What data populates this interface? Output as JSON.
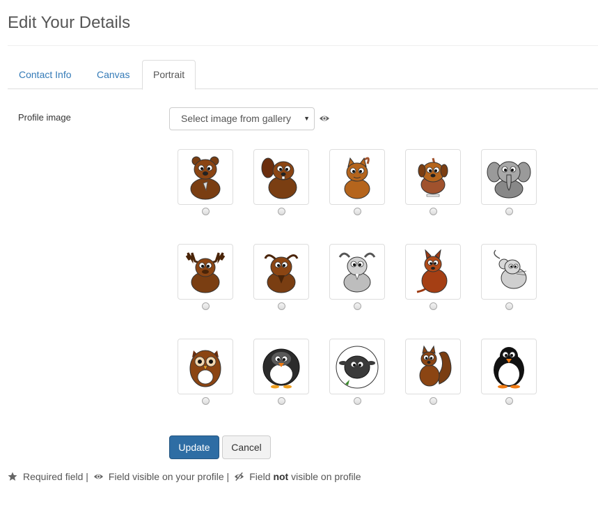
{
  "page": {
    "title": "Edit Your Details"
  },
  "tabs": [
    {
      "label": "Contact Info",
      "active": false
    },
    {
      "label": "Canvas",
      "active": false
    },
    {
      "label": "Portrait",
      "active": true
    }
  ],
  "form": {
    "profile_image_label": "Profile image",
    "select_value": "Select image from gallery",
    "select_icon": "chevron-down-icon",
    "visibility_icon": "eye-icon"
  },
  "gallery": {
    "selected_index": null,
    "images": [
      {
        "name": "bear"
      },
      {
        "name": "beaver"
      },
      {
        "name": "cat"
      },
      {
        "name": "dog"
      },
      {
        "name": "elephant"
      },
      {
        "name": "moose"
      },
      {
        "name": "gnu"
      },
      {
        "name": "goat"
      },
      {
        "name": "kangaroo"
      },
      {
        "name": "mouse"
      },
      {
        "name": "owl"
      },
      {
        "name": "penguin-grey"
      },
      {
        "name": "sheep"
      },
      {
        "name": "squirrel"
      },
      {
        "name": "penguin"
      }
    ]
  },
  "buttons": {
    "update": "Update",
    "cancel": "Cancel"
  },
  "legend": {
    "required": "Required field |",
    "visible": "Field visible on your profile |",
    "not_visible_prefix": "Field",
    "not_visible_bold": "not",
    "not_visible_suffix": "visible on profile"
  },
  "colors": {
    "link": "#337ab7",
    "primary": "#2e6da4",
    "brown": "#7a3e12",
    "dark_brown": "#4a2408"
  }
}
